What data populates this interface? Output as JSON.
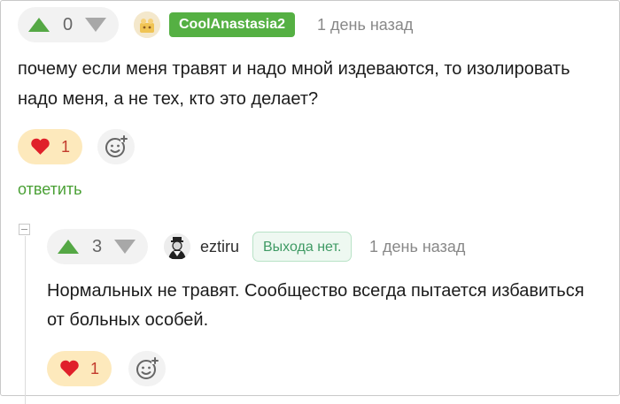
{
  "comment": {
    "rating": "0",
    "author": "CoolAnastasia2",
    "time": "1 день назад",
    "text_line1": "почему если меня травят и надо мной издеваются, то изолировать",
    "text_line2": "надо меня, а не тех, кто это делает?",
    "likes": "1",
    "reply_label": "ответить"
  },
  "reply": {
    "rating": "3",
    "author": "eztiru",
    "status": "Выхода нет.",
    "time": "1 день назад",
    "text_line1": "Нормальных не травят. Сообщество всегда пытается избавиться",
    "text_line2": "от больных особей.",
    "likes": "1"
  },
  "colors": {
    "upvote": "#55a845",
    "nick_badge": "#55b043",
    "like_bg": "#fde9bc",
    "heart": "#e0202a",
    "reply_link": "#4aa035",
    "status_text": "#3f9a64"
  },
  "icons": [
    "upvote-icon",
    "downvote-icon",
    "heart-icon",
    "add-reaction-icon",
    "collapse-icon"
  ]
}
